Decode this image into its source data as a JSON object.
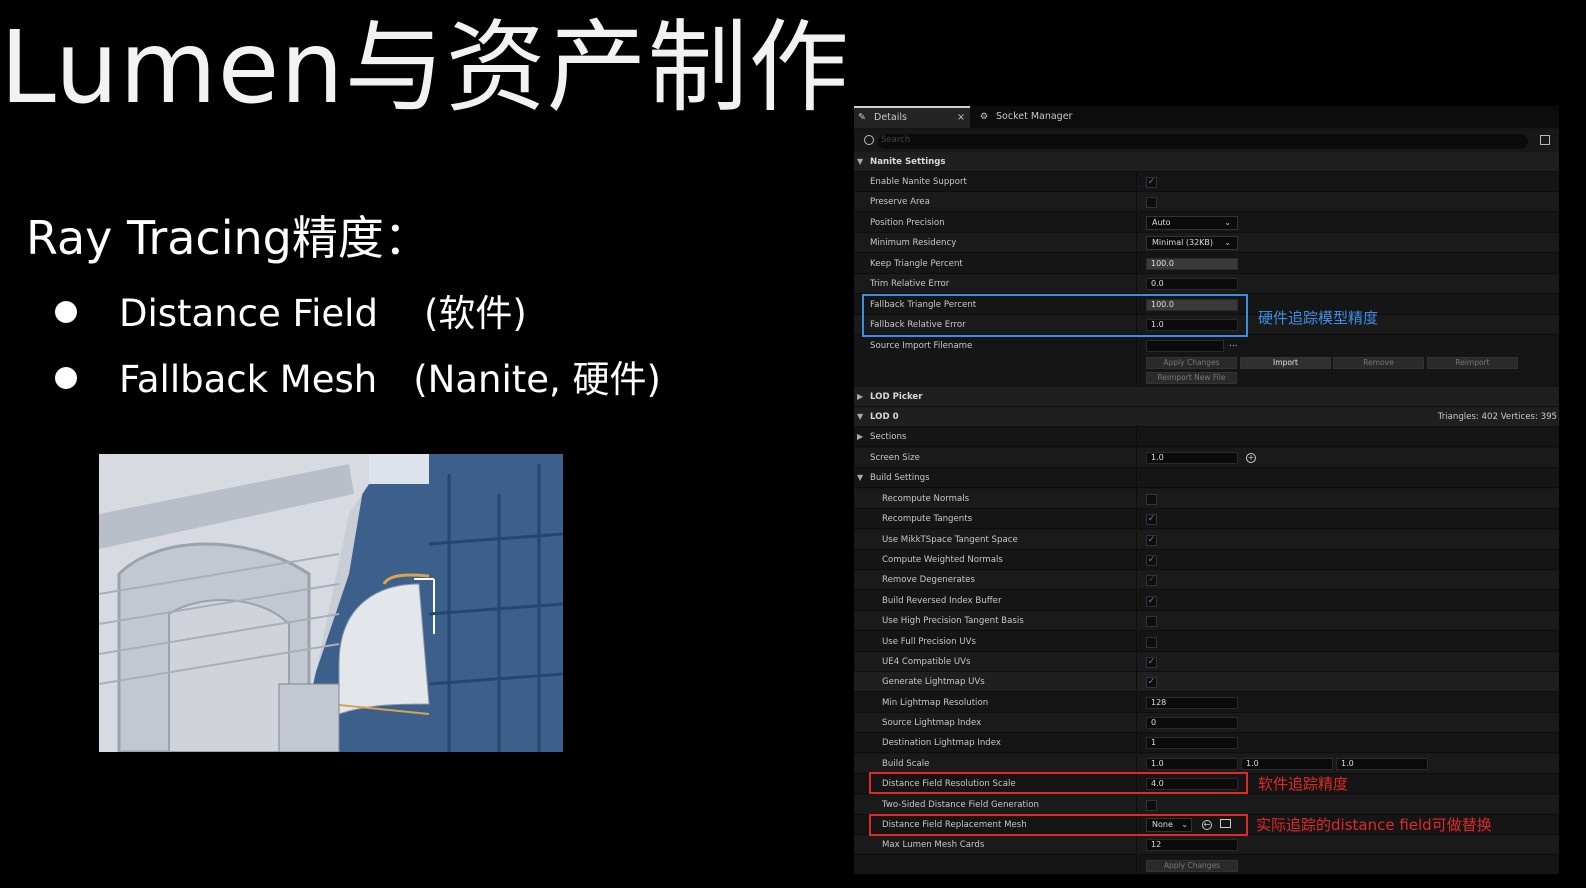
{
  "slide": {
    "title": "Lumen与资产制作",
    "subheading": "Ray Tracing精度：",
    "bullets": [
      {
        "name": "Distance Field",
        "note": "(软件)"
      },
      {
        "name": "Fallback Mesh",
        "note": "(Nanite, 硬件)"
      }
    ]
  },
  "panel": {
    "tabs": [
      {
        "label": "Details",
        "close": "×"
      },
      {
        "label": "Socket Manager"
      }
    ],
    "search_placeholder": "Search",
    "nanite": {
      "header": "Nanite Settings",
      "enable_label": "Enable Nanite Support",
      "preserve_label": "Preserve Area",
      "position_label": "Position Precision",
      "position_value": "Auto",
      "residency_label": "Minimum Residency",
      "residency_value": "Minimal (32KB)",
      "keep_label": "Keep Triangle Percent",
      "keep_value": "100.0",
      "trim_label": "Trim Relative Error",
      "trim_value": "0.0",
      "fallback_pct_label": "Fallback Triangle Percent",
      "fallback_pct_value": "100.0",
      "fallback_err_label": "Fallback Relative Error",
      "fallback_err_value": "1.0",
      "source_label": "Source Import Filename",
      "source_more": "...",
      "buttons": [
        "Apply Changes",
        "Import",
        "Remove",
        "Reimport"
      ],
      "reimport_new": "Reimport New File"
    },
    "lod_picker": "LOD Picker",
    "lod0": {
      "header": "LOD 0",
      "stats": "Triangles: 402   Vertices: 395"
    },
    "sections": "Sections",
    "screen_size_label": "Screen Size",
    "screen_size_value": "1.0",
    "build": {
      "header": "Build Settings",
      "recompute_normals": "Recompute Normals",
      "recompute_tangents": "Recompute Tangents",
      "mikkt": "Use MikkTSpace Tangent Space",
      "weighted": "Compute Weighted Normals",
      "degenerates": "Remove Degenerates",
      "reversed": "Build Reversed Index Buffer",
      "high_prec": "Use High Precision Tangent Basis",
      "full_prec": "Use Full Precision UVs",
      "ue4": "UE4 Compatible UVs",
      "gen_lightmap": "Generate Lightmap UVs",
      "min_lm_label": "Min Lightmap Resolution",
      "min_lm_value": "128",
      "src_lm_label": "Source Lightmap Index",
      "src_lm_value": "0",
      "dst_lm_label": "Destination Lightmap Index",
      "dst_lm_value": "1",
      "scale_label": "Build Scale",
      "scale_x": "1.0",
      "scale_y": "1.0",
      "scale_z": "1.0",
      "df_res_label": "Distance Field Resolution Scale",
      "df_res_value": "4.0",
      "two_sided": "Two-Sided Distance Field Generation",
      "df_replace_label": "Distance Field Replacement Mesh",
      "df_replace_value": "None",
      "max_cards_label": "Max Lumen Mesh Cards",
      "max_cards_value": "12",
      "apply": "Apply Changes"
    }
  },
  "annotations": {
    "hardware": "硬件追踪模型精度",
    "software": "软件追踪精度",
    "replace": "实际追踪的distance field可做替换"
  },
  "colors": {
    "blue_note": "#3a8ee6",
    "red_note": "#e02828",
    "check": "#4f86d8"
  }
}
